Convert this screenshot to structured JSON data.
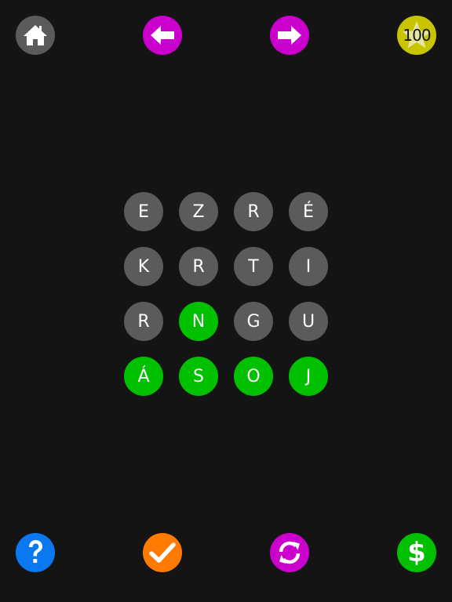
{
  "colors": {
    "background": "#141414",
    "tile_default": "#5b5b5b",
    "tile_selected": "#00c000",
    "home": "#5b5b5b",
    "nav": "#cc00cc",
    "score": "#c9c400",
    "help": "#0a78f0",
    "check": "#ff7a00",
    "shuffle": "#cc00cc",
    "shop": "#00c000"
  },
  "top_bar": {
    "home_icon": "house-icon",
    "prev_icon": "arrow-left-icon",
    "next_icon": "arrow-right-icon",
    "score_icon": "star-icon",
    "score_value": "100"
  },
  "bottom_bar": {
    "help_icon": "question-mark-icon",
    "check_icon": "checkmark-icon",
    "shuffle_icon": "refresh-icon",
    "shop_icon": "dollar-icon",
    "shop_label": "$"
  },
  "grid": {
    "rows": [
      [
        {
          "letter": "E",
          "selected": false
        },
        {
          "letter": "Z",
          "selected": false
        },
        {
          "letter": "R",
          "selected": false
        },
        {
          "letter": "É",
          "selected": false
        }
      ],
      [
        {
          "letter": "K",
          "selected": false
        },
        {
          "letter": "R",
          "selected": false
        },
        {
          "letter": "T",
          "selected": false
        },
        {
          "letter": "I",
          "selected": false
        }
      ],
      [
        {
          "letter": "R",
          "selected": false
        },
        {
          "letter": "N",
          "selected": true
        },
        {
          "letter": "G",
          "selected": false
        },
        {
          "letter": "U",
          "selected": false
        }
      ],
      [
        {
          "letter": "Á",
          "selected": true
        },
        {
          "letter": "S",
          "selected": true
        },
        {
          "letter": "O",
          "selected": true
        },
        {
          "letter": "J",
          "selected": true
        }
      ]
    ]
  }
}
